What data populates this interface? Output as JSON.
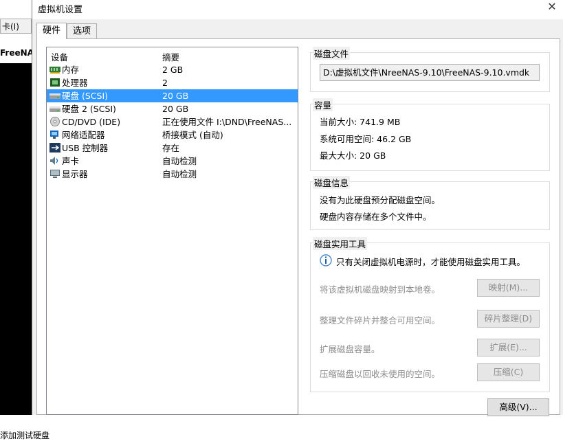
{
  "background": {
    "menu_label": "卡(I)",
    "vm_label": "FreeNAS",
    "footer_text": "添加测试硬盘"
  },
  "dialog": {
    "title": "虚拟机设置",
    "tabs": [
      {
        "label": "硬件",
        "active": true
      },
      {
        "label": "选项",
        "active": false
      }
    ],
    "devices": {
      "headers": {
        "device": "设备",
        "summary": "摘要"
      },
      "rows": [
        {
          "icon": "memory-icon",
          "name": "内存",
          "summary": "2 GB",
          "selected": false
        },
        {
          "icon": "processor-icon",
          "name": "处理器",
          "summary": "2",
          "selected": false
        },
        {
          "icon": "hard-disk-icon",
          "name": "硬盘 (SCSI)",
          "summary": "20 GB",
          "selected": true
        },
        {
          "icon": "hard-disk-icon",
          "name": "硬盘 2 (SCSI)",
          "summary": "20 GB",
          "selected": false
        },
        {
          "icon": "cd-dvd-icon",
          "name": "CD/DVD (IDE)",
          "summary": "正在使用文件 I:\\DND\\FreeNAS...",
          "selected": false
        },
        {
          "icon": "network-adapter-icon",
          "name": "网络适配器",
          "summary": "桥接模式 (自动)",
          "selected": false
        },
        {
          "icon": "usb-icon",
          "name": "USB 控制器",
          "summary": "存在",
          "selected": false
        },
        {
          "icon": "sound-card-icon",
          "name": "声卡",
          "summary": "自动检测",
          "selected": false
        },
        {
          "icon": "display-icon",
          "name": "显示器",
          "summary": "自动检测",
          "selected": false
        }
      ]
    },
    "disk_file": {
      "title": "磁盘文件",
      "path": "D:\\虚拟机文件\\NreeNAS-9.10\\FreeNAS-9.10.vmdk"
    },
    "capacity": {
      "title": "容量",
      "current_size": "当前大小: 741.9 MB",
      "available": "系统可用空间: 46.2 GB",
      "max_size": "最大大小: 20 GB"
    },
    "disk_info": {
      "title": "磁盘信息",
      "line1": "没有为此硬盘预分配磁盘空间。",
      "line2": "硬盘内容存储在多个文件中。"
    },
    "utilities": {
      "title": "磁盘实用工具",
      "info": "只有关闭虚拟机电源时，才能使用磁盘实用工具。",
      "items": [
        {
          "text": "将该虚拟机磁盘映射到本地卷。",
          "button": "映射(M)..."
        },
        {
          "text": "整理文件碎片并整合可用空间。",
          "button": "碎片整理(D)"
        },
        {
          "text": "扩展磁盘容量。",
          "button": "扩展(E)..."
        },
        {
          "text": "压缩磁盘以回收未使用的空间。",
          "button": "压缩(C)"
        }
      ]
    },
    "advanced_button": "高级(V)...",
    "colors": {
      "selection": "#3399ff",
      "dialog_bg": "#f0f0f0"
    }
  }
}
